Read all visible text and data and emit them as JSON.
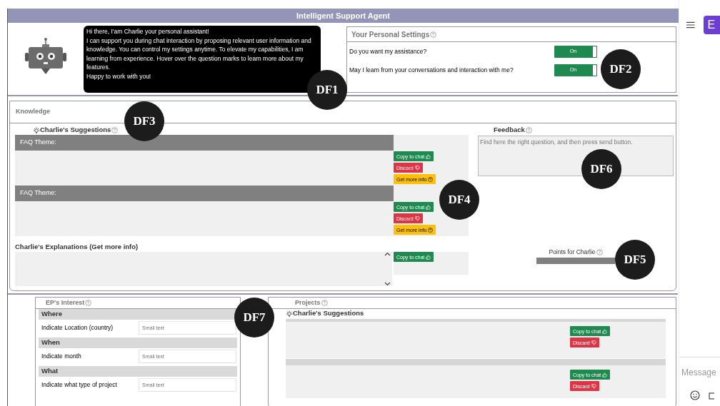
{
  "title": "Intelligent Support Agent",
  "bubble": [
    "Hi there, I'am Charlie your personal assistant!",
    "I can support you during chat interaction by proposing relevant user information and knowledge. You can control my settings anytime. To elevate my capabilities, I am learning from experience. Hover over the question marks to learn more about my features.",
    "Happy to work with you!"
  ],
  "settings": {
    "title": "Your Personal Settings",
    "toggles": [
      {
        "question": "Do you want my assistance?",
        "label": "On",
        "on": true
      },
      {
        "question": "May I learn from your conversations and interaction with me?",
        "label": "On",
        "on": true
      }
    ]
  },
  "knowledge": {
    "title": "Knowledge",
    "suggestions_title": "Charlie's Suggestions",
    "faq": [
      {
        "theme": "FAQ Theme:",
        "buttons": [
          {
            "kind": "copy",
            "label": "Copy to chat"
          },
          {
            "kind": "discard",
            "label": "Discard"
          },
          {
            "kind": "info",
            "label": "Get more info"
          }
        ]
      },
      {
        "theme": "FAQ Theme:",
        "buttons": [
          {
            "kind": "copy",
            "label": "Copy to chat"
          },
          {
            "kind": "discard",
            "label": "Discard"
          },
          {
            "kind": "info",
            "label": "Get more info"
          }
        ]
      }
    ],
    "explanations_title": "Charlie's Explanations (Get more info)",
    "explanations_buttons": [
      {
        "kind": "copy",
        "label": "Copy to chat"
      }
    ],
    "feedback_title": "Feedback",
    "feedback_placeholder": "Find here the right question, and then press send button.",
    "points_label": "Points for Charlie"
  },
  "interest": {
    "title": "EP's Interest",
    "groups": [
      {
        "heading": "Where",
        "label": "Indicate Location (country)",
        "placeholder": "Small text"
      },
      {
        "heading": "When",
        "label": "Indicate month",
        "placeholder": "Small text"
      },
      {
        "heading": "What",
        "label": "Indicate what type of project",
        "placeholder": "Small text"
      }
    ]
  },
  "projects": {
    "title": "Projects",
    "suggestions_title": "Charlie's Suggestions",
    "items": [
      {
        "buttons": [
          {
            "kind": "copy",
            "label": "Copy to chat"
          },
          {
            "kind": "discard",
            "label": "Discard"
          }
        ]
      },
      {
        "buttons": [
          {
            "kind": "copy",
            "label": "Copy to chat"
          },
          {
            "kind": "discard",
            "label": "Discard"
          }
        ]
      }
    ]
  },
  "side": {
    "button": "E",
    "message_placeholder": "Message"
  },
  "callouts": [
    {
      "label": "DF1"
    },
    {
      "label": "DF2"
    },
    {
      "label": "DF3"
    },
    {
      "label": "DF4"
    },
    {
      "label": "DF5"
    },
    {
      "label": "DF6"
    },
    {
      "label": "DF7"
    }
  ]
}
